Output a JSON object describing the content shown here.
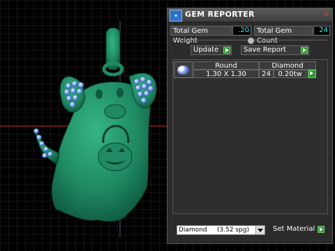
{
  "window": {
    "title": "GEM REPORTER",
    "icon": "app-logo-icon",
    "close_icon": "close-icon"
  },
  "stats": {
    "weight_label": "Total Gem Weight",
    "weight_value": ".20",
    "count_label": "Total Gem Count",
    "count_value": "24"
  },
  "actions": {
    "update_label": "Update",
    "save_label": "Save Report"
  },
  "gem_list": {
    "rows": [
      {
        "shape": "Round",
        "size": "1.30 X 1.30",
        "material": "Diamond",
        "count": "24",
        "weight": "0.20tw",
        "thumb_icon": "round-gem-icon"
      }
    ]
  },
  "footer": {
    "material_selected": "Diamond     (3.52 spg)",
    "set_material_label": "Set Material"
  },
  "colors": {
    "model": "#1f8a63",
    "gems": "#8ab4f0",
    "grid": "#2a2a2a",
    "value_text": "#22ffff",
    "go_button": "#2a9a2a"
  }
}
